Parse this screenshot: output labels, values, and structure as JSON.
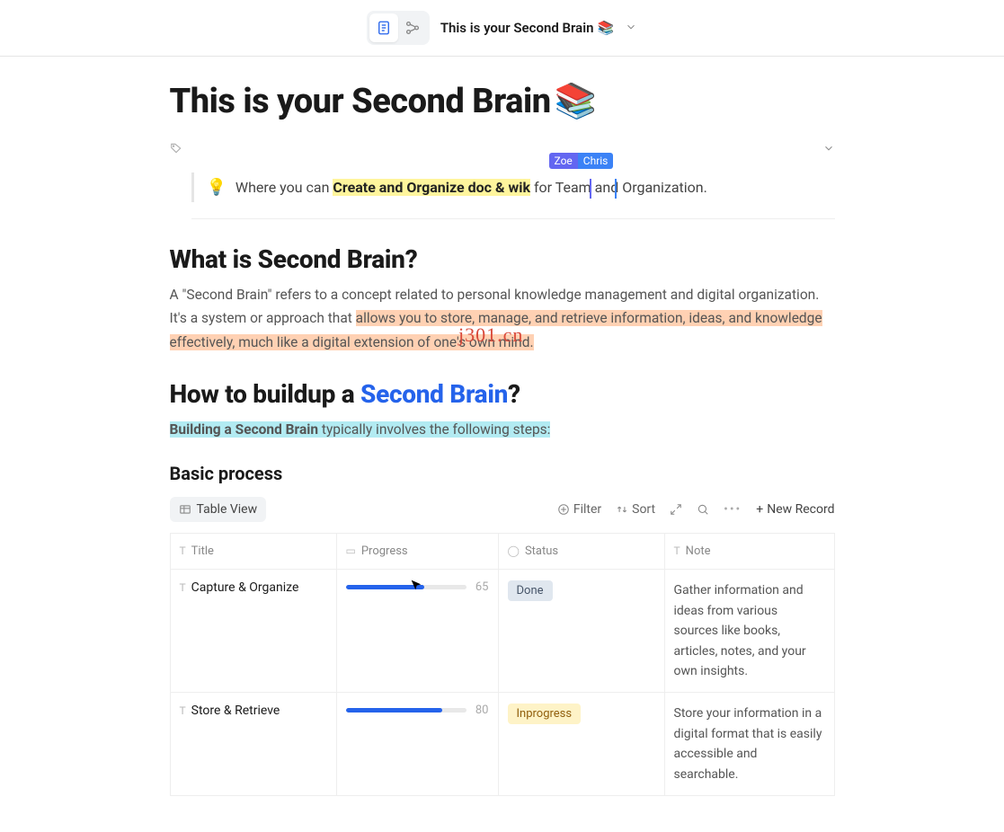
{
  "topbar": {
    "title": "This is your Second Brain",
    "emoji": "📚"
  },
  "page": {
    "h1": "This is your Second Brain",
    "h1_emoji": "📚",
    "callout": {
      "pre": "Where you can ",
      "highlight": "Create and Organize doc & wik",
      "mid": " for ",
      "post": "Team and Organization."
    },
    "collab": {
      "user1": "Zoe",
      "user2": "Chris"
    },
    "h2_what": "What is Second Brain?",
    "what_p_pre": "A \"Second Brain\" refers to a concept related to personal knowledge management and digital organization. It's a system or approach that ",
    "what_p_hl": "allows you to store, manage, and retrieve information, ideas, and knowledge effectively, much like a digital extension of one's own mind.",
    "h2_how_pre": "How to buildup a ",
    "h2_how_link": "Second Brain",
    "h2_how_post": "?",
    "how_p_hl": "Building a Second Brain",
    "how_p_post": " typically involves the following steps:",
    "basic_process": "Basic process"
  },
  "table_toolbar": {
    "view": "Table View",
    "filter": "Filter",
    "sort": "Sort",
    "new_record": "New Record"
  },
  "table": {
    "cols": {
      "title": "Title",
      "progress": "Progress",
      "status": "Status",
      "note": "Note"
    },
    "rows": [
      {
        "title": "Capture & Organize",
        "progress": 65,
        "status": "Done",
        "status_class": "done",
        "note": "Gather information and ideas from various sources like books, articles, notes, and your own insights."
      },
      {
        "title": "Store & Retrieve",
        "progress": 80,
        "status": "Inprogress",
        "status_class": "inprog",
        "note": "Store your information in a digital format that is easily accessible and searchable."
      }
    ]
  },
  "watermark": "j301.cn"
}
